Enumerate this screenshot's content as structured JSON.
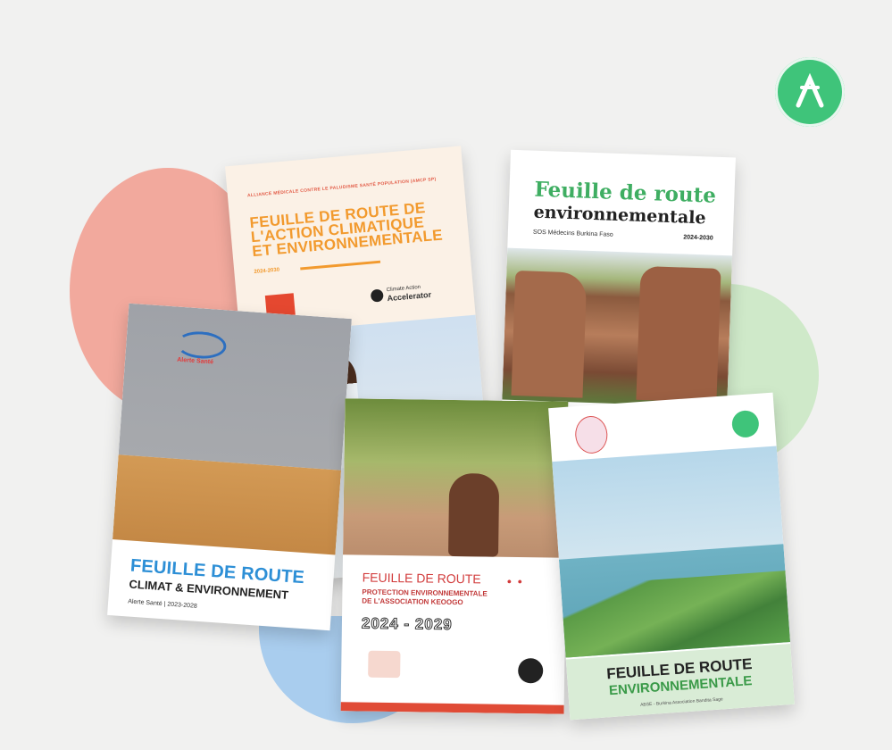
{
  "colors": {
    "accent_green": "#3fc47a",
    "pink": "#f2a99d",
    "blue": "#a9cdee"
  },
  "icons": {
    "corner": "climate-action-accelerator-logo"
  },
  "cards": {
    "c1": {
      "org_line": "ALLIANCE MÉDICALE CONTRE LE PALUDISME SANTÉ POPULATION (AMCP SP)",
      "title_lines": [
        "FEUILLE DE ROUTE DE",
        "L'ACTION CLIMATIQUE",
        "ET ENVIRONNEMENTALE"
      ],
      "years": "2024-2030",
      "cta_small": "Climate Action",
      "cta_big": "Accelerator"
    },
    "c2": {
      "title_top": "Feuille de route",
      "title_bottom": "environnementale",
      "subtitle": "SOS Médecins Burkina Faso",
      "years": "2024-2030"
    },
    "c3": {
      "logo_text": "Alerte Santé",
      "title": "FEUILLE DE ROUTE",
      "subtitle": "CLIMAT & ENVIRONNEMENT",
      "footer": "Alerte Santé | 2023-2028"
    },
    "c4": {
      "title": "FEUILLE DE ROUTE",
      "subtitle_lines": [
        "PROTECTION ENVIRONNEMENTALE",
        "DE L'ASSOCIATION KEOOGO"
      ],
      "years": "2024 - 2029"
    },
    "c5": {
      "title": "FEUILLE DE ROUTE",
      "subtitle": "ENVIRONNEMENTALE",
      "footer": "ABSE - Burkina Association Bandita Sage"
    }
  }
}
